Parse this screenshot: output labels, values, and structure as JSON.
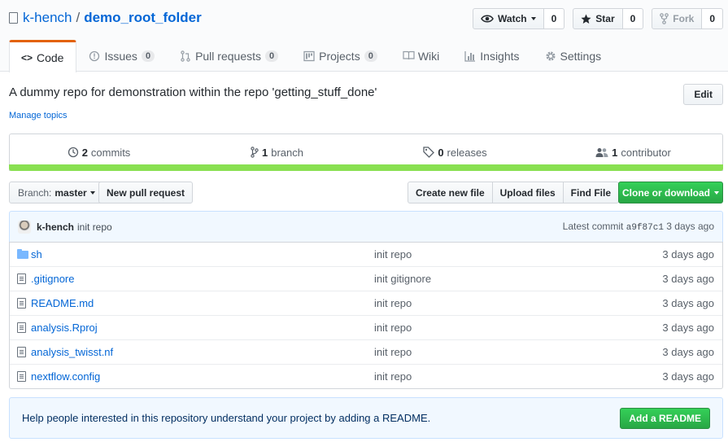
{
  "repo": {
    "owner": "k-hench",
    "separator": "/",
    "name": "demo_root_folder"
  },
  "actions": {
    "watch": {
      "label": "Watch",
      "count": "0",
      "icon": "eye-icon"
    },
    "star": {
      "label": "Star",
      "count": "0",
      "icon": "star-icon"
    },
    "fork": {
      "label": "Fork",
      "count": "0",
      "icon": "fork-icon"
    }
  },
  "tabs": [
    {
      "label": "Code",
      "icon": "code-icon",
      "counter": ""
    },
    {
      "label": "Issues",
      "icon": "issue-icon",
      "counter": "0"
    },
    {
      "label": "Pull requests",
      "icon": "pull-request-icon",
      "counter": "0"
    },
    {
      "label": "Projects",
      "icon": "project-icon",
      "counter": "0"
    },
    {
      "label": "Wiki",
      "icon": "book-icon",
      "counter": ""
    },
    {
      "label": "Insights",
      "icon": "graph-icon",
      "counter": ""
    },
    {
      "label": "Settings",
      "icon": "gear-icon",
      "counter": ""
    }
  ],
  "description": "A dummy repo for demonstration within the repo 'getting_stuff_done'",
  "manage_topics": "Manage topics",
  "edit_label": "Edit",
  "summary": {
    "commits": {
      "count": "2",
      "label": "commits"
    },
    "branches": {
      "count": "1",
      "label": "branch"
    },
    "releases": {
      "count": "0",
      "label": "releases"
    },
    "contributors": {
      "count": "1",
      "label": "contributor"
    }
  },
  "language_color": "#89e051",
  "branch": {
    "prefix": "Branch:",
    "name": "master"
  },
  "new_pull_request": "New pull request",
  "file_actions": {
    "create": "Create new file",
    "upload": "Upload files",
    "find": "Find File",
    "clone": "Clone or download"
  },
  "latest_commit": {
    "author": "k-hench",
    "message": "init repo",
    "prefix": "Latest commit",
    "sha": "a9f87c1",
    "age": "3 days ago"
  },
  "files": [
    {
      "type": "folder",
      "name": "sh",
      "message": "init repo",
      "age": "3 days ago"
    },
    {
      "type": "file",
      "name": ".gitignore",
      "message": "init gitignore",
      "age": "3 days ago"
    },
    {
      "type": "file",
      "name": "README.md",
      "message": "init repo",
      "age": "3 days ago"
    },
    {
      "type": "file",
      "name": "analysis.Rproj",
      "message": "init repo",
      "age": "3 days ago"
    },
    {
      "type": "file",
      "name": "analysis_twisst.nf",
      "message": "init repo",
      "age": "3 days ago"
    },
    {
      "type": "file",
      "name": "nextflow.config",
      "message": "init repo",
      "age": "3 days ago"
    }
  ],
  "readme_prompt": {
    "text": "Help people interested in this repository understand your project by adding a README.",
    "button": "Add a README"
  }
}
